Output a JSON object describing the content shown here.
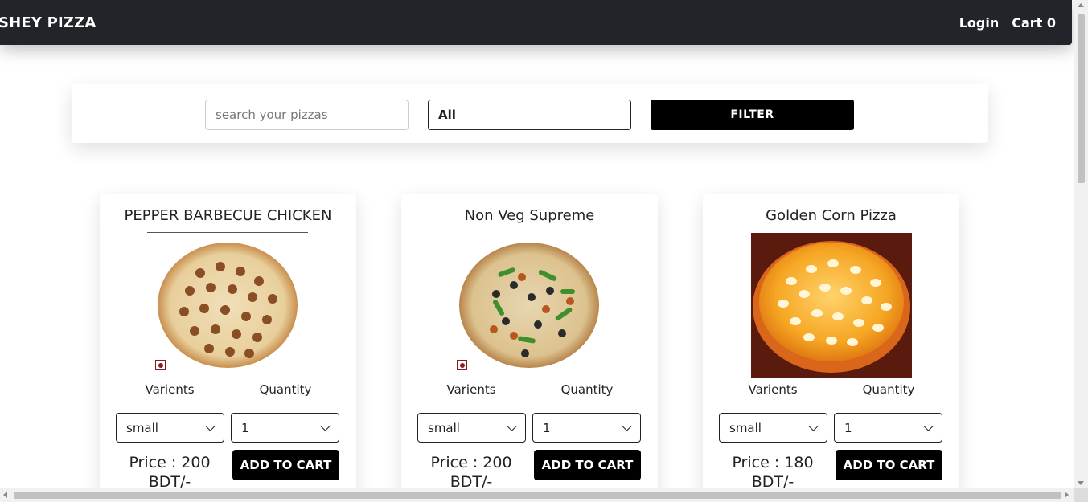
{
  "navbar": {
    "brand": "SHEY PIZZA",
    "login_label": "Login",
    "cart_label": "Cart 0"
  },
  "filter": {
    "search_placeholder": "search your pizzas",
    "category_value": "All",
    "button_label": "FILTER"
  },
  "pizzas": [
    {
      "name": "PEPPER BARBECUE CHICKEN",
      "varients_label": "Varients",
      "quantity_label": "Quantity",
      "varient_value": "small",
      "quantity_value": "1",
      "price": "Price : 200 BDT/-",
      "button_label": "ADD TO CART"
    },
    {
      "name": "Non Veg Supreme",
      "varients_label": "Varients",
      "quantity_label": "Quantity",
      "varient_value": "small",
      "quantity_value": "1",
      "price": "Price : 200 BDT/-",
      "button_label": "ADD TO CART"
    },
    {
      "name": "Golden Corn Pizza",
      "varients_label": "Varients",
      "quantity_label": "Quantity",
      "varient_value": "small",
      "quantity_value": "1",
      "price": "Price : 180 BDT/-",
      "button_label": "ADD TO CART"
    }
  ],
  "colors": {
    "navbar_bg": "#212529",
    "button_bg": "#000000",
    "nonveg_mark": "#8b1a1a"
  }
}
